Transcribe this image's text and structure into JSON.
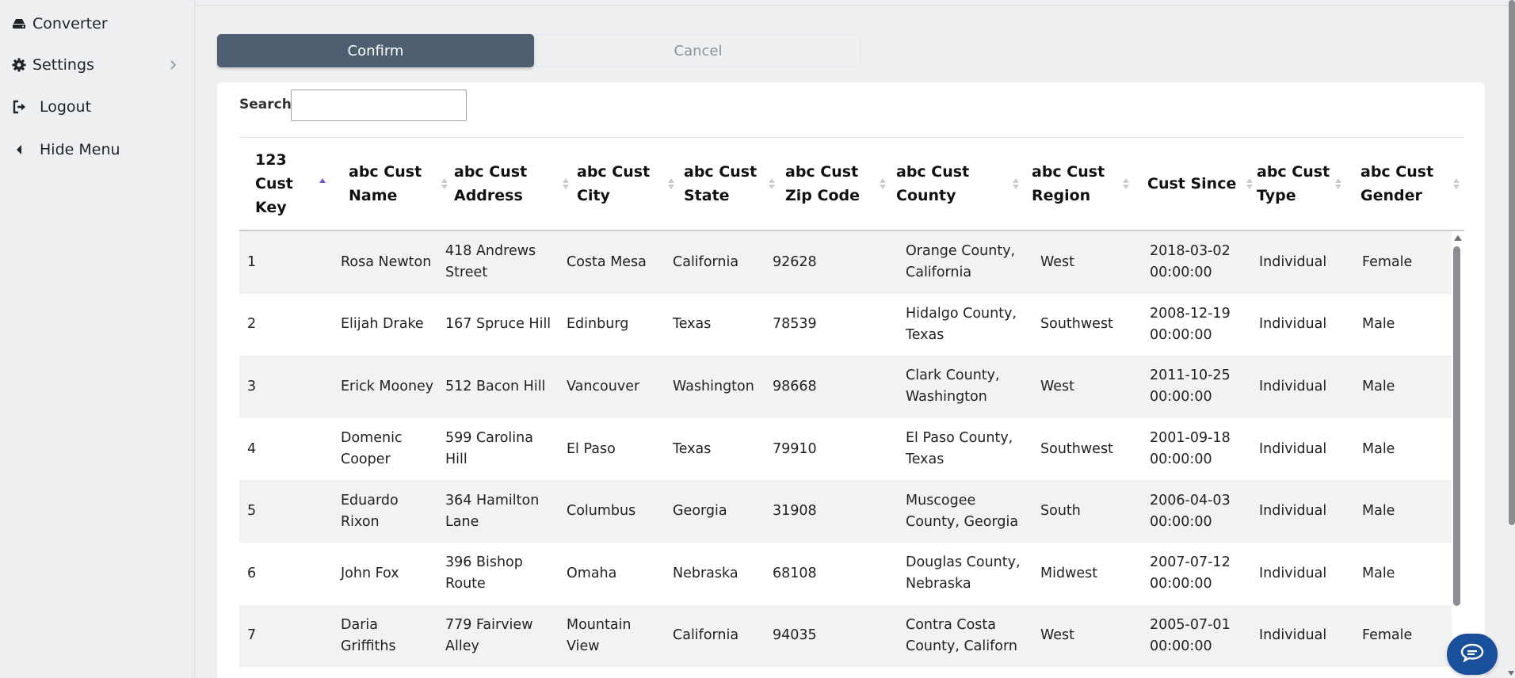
{
  "sidebar": {
    "items": [
      {
        "label": "Converter",
        "icon": "drive-icon"
      },
      {
        "label": "Settings",
        "icon": "gear-icon"
      },
      {
        "label": "Logout",
        "icon": "logout-icon"
      },
      {
        "label": "Hide Menu",
        "icon": "caret-left-icon"
      }
    ]
  },
  "actions": {
    "confirm_label": "Confirm",
    "cancel_label": "Cancel"
  },
  "search": {
    "label": "Search:",
    "value": "",
    "placeholder": ""
  },
  "table": {
    "columns": [
      {
        "label": "123 Cust Key",
        "sorted": "asc"
      },
      {
        "label": "abc Cust Name"
      },
      {
        "label": "abc Cust Address"
      },
      {
        "label": "abc Cust City"
      },
      {
        "label": "abc Cust State"
      },
      {
        "label": "abc Cust Zip Code"
      },
      {
        "label": "abc Cust County"
      },
      {
        "label": "abc Cust Region"
      },
      {
        "label": "Cust Since"
      },
      {
        "label": "abc Cust Type"
      },
      {
        "label": "abc Cust Gender"
      }
    ],
    "rows": [
      [
        "1",
        "Rosa Newton",
        "418 Andrews Street",
        "Costa Mesa",
        "California",
        "92628",
        "Orange County, California",
        "West",
        "2018-03-02 00:00:00",
        "Individual",
        "Female"
      ],
      [
        "2",
        "Elijah Drake",
        "167 Spruce Hill",
        "Edinburg",
        "Texas",
        "78539",
        "Hidalgo County, Texas",
        "Southwest",
        "2008-12-19 00:00:00",
        "Individual",
        "Male"
      ],
      [
        "3",
        "Erick Mooney",
        "512 Bacon Hill",
        "Vancouver",
        "Washington",
        "98668",
        "Clark County, Washington",
        "West",
        "2011-10-25 00:00:00",
        "Individual",
        "Male"
      ],
      [
        "4",
        "Domenic Cooper",
        "599 Carolina Hill",
        "El Paso",
        "Texas",
        "79910",
        "El Paso County, Texas",
        "Southwest",
        "2001-09-18 00:00:00",
        "Individual",
        "Male"
      ],
      [
        "5",
        "Eduardo Rixon",
        "364 Hamilton Lane",
        "Columbus",
        "Georgia",
        "31908",
        "Muscogee County, Georgia",
        "South",
        "2006-04-03 00:00:00",
        "Individual",
        "Male"
      ],
      [
        "6",
        "John Fox",
        "396 Bishop Route",
        "Omaha",
        "Nebraska",
        "68108",
        "Douglas County, Nebraska",
        "Midwest",
        "2007-07-12 00:00:00",
        "Individual",
        "Male"
      ],
      [
        "7",
        "Daria Griffiths",
        "779 Fairview Alley",
        "Mountain View",
        "California",
        "94035",
        "Contra Costa County, Californ",
        "West",
        "2005-07-01 00:00:00",
        "Individual",
        "Female"
      ]
    ]
  },
  "colors": {
    "confirm_bg": "#4d5f70",
    "sort_active": "#6a5acd",
    "chat_bg": "#1a4f9c"
  }
}
